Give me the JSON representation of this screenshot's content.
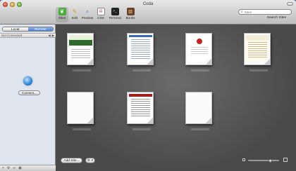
{
  "window": {
    "title": "Coda"
  },
  "toolbar": {
    "tools": [
      {
        "label": "Sites",
        "icon": "leaf-icon",
        "color": "#4caf3c"
      },
      {
        "label": "Edit",
        "icon": "pencil-icon",
        "color": "#e0a32a"
      },
      {
        "label": "Preview",
        "icon": "magnifier-icon",
        "color": "#3b78c4"
      },
      {
        "label": "CSS",
        "icon": "css-icon",
        "color": "#8a8a8a"
      },
      {
        "label": "Terminal",
        "icon": "terminal-icon",
        "color": "#222222"
      },
      {
        "label": "Books",
        "icon": "books-icon",
        "color": "#7a4b2a"
      }
    ],
    "active_tool": "Sites",
    "search": {
      "placeholder": "Sites",
      "label": "Search Sites"
    }
  },
  "sidebar": {
    "segments": {
      "local": "Local",
      "remote": "Remote",
      "selected": "Remote"
    },
    "connection_status": "Not Connected",
    "connect_button": "Connect..."
  },
  "sites": [
    {
      "thumbnail": "green"
    },
    {
      "thumbnail": "blue"
    },
    {
      "thumbnail": "red"
    },
    {
      "thumbnail": "beige"
    },
    {
      "thumbnail": "blank"
    },
    {
      "thumbnail": "red-header"
    },
    {
      "thumbnail": "blank"
    }
  ],
  "bottom_bar": {
    "add_site_label": "Add Site...",
    "gear_label": "⚙ ▾",
    "thumbnail_size_fraction": 0.72
  }
}
